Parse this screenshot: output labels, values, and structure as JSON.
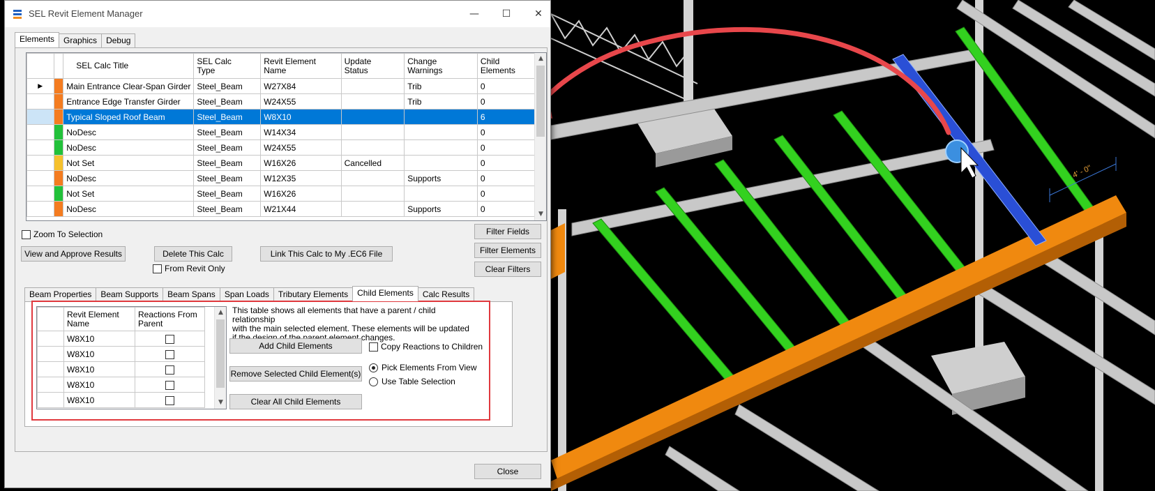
{
  "window": {
    "title": "SEL Revit Element Manager",
    "minimize_glyph": "—",
    "maximize_glyph": "☐",
    "close_glyph": "✕"
  },
  "top_tabs": [
    "Elements",
    "Graphics",
    "Debug"
  ],
  "grid": {
    "columns": [
      "SEL Calc Title",
      "SEL Calc\nType",
      "Revit Element\nName",
      "Update\nStatus",
      "Change\nWarnings",
      "Child\nElements"
    ],
    "rows": [
      {
        "marker": "▶",
        "color": "#f47c20",
        "title": "Main Entrance Clear-Span Girder",
        "type": "Steel_Beam",
        "name": "W27X84",
        "status": "",
        "warnings": "Trib",
        "child": "0"
      },
      {
        "marker": "",
        "color": "#f47c20",
        "title": "Entrance Edge Transfer Girder",
        "type": "Steel_Beam",
        "name": "W24X55",
        "status": "",
        "warnings": "Trib",
        "child": "0"
      },
      {
        "marker": "",
        "color": "#f47c20",
        "title": "Typical Sloped Roof Beam",
        "type": "Steel_Beam",
        "name": "W8X10",
        "status": "",
        "warnings": "",
        "child": "6"
      },
      {
        "marker": "",
        "color": "#22c13a",
        "title": "NoDesc",
        "type": "Steel_Beam",
        "name": "W14X34",
        "status": "",
        "warnings": "",
        "child": "0"
      },
      {
        "marker": "",
        "color": "#22c13a",
        "title": "NoDesc",
        "type": "Steel_Beam",
        "name": "W24X55",
        "status": "",
        "warnings": "",
        "child": "0"
      },
      {
        "marker": "",
        "color": "#f6c12d",
        "title": "Not Set",
        "type": "Steel_Beam",
        "name": "W16X26",
        "status": "Cancelled",
        "warnings": "",
        "child": "0"
      },
      {
        "marker": "",
        "color": "#f47c20",
        "title": "NoDesc",
        "type": "Steel_Beam",
        "name": "W12X35",
        "status": "",
        "warnings": "Supports",
        "child": "0"
      },
      {
        "marker": "",
        "color": "#22c13a",
        "title": "Not Set",
        "type": "Steel_Beam",
        "name": "W16X26",
        "status": "",
        "warnings": "",
        "child": "0"
      },
      {
        "marker": "",
        "color": "#f47c20",
        "title": "NoDesc",
        "type": "Steel_Beam",
        "name": "W21X44",
        "status": "",
        "warnings": "Supports",
        "child": "0"
      }
    ],
    "selected_index": 2
  },
  "controls": {
    "zoom_to_selection": "Zoom To Selection",
    "view_approve": "View and Approve Results",
    "delete_calc": "Delete This Calc",
    "from_revit_only": "From Revit Only",
    "link_calc": "Link This Calc to My .EC6 File",
    "filter_fields": "Filter Fields",
    "filter_elements": "Filter Elements",
    "clear_filters": "Clear Filters",
    "close": "Close"
  },
  "sub_tabs": [
    "Beam Properties",
    "Beam Supports",
    "Beam Spans",
    "Span Loads",
    "Tributary Elements",
    "Child Elements",
    "Calc Results"
  ],
  "child_panel": {
    "columns": [
      "Revit Element\nName",
      "Reactions From\nParent"
    ],
    "rows": [
      "W8X10",
      "W8X10",
      "W8X10",
      "W8X10",
      "W8X10"
    ],
    "description": [
      "This table shows all elements that have a parent / child relationship",
      "with the main selected element.  These elements will be updated",
      "if the design of the parent element changes."
    ],
    "add_child": "Add Child Elements",
    "remove_child": "Remove Selected Child Element(s)",
    "clear_child": "Clear All Child Elements",
    "copy_reactions": "Copy Reactions to Children",
    "pick_from_view": "Pick Elements From View",
    "use_table_selection": "Use Table Selection"
  },
  "scene": {
    "dimension_label": "4' - 0\"",
    "colors": {
      "steel": "#bdbdbd",
      "highlight_green": "#33d11f",
      "girder_orange": "#f0890f",
      "selected_blue": "#2a4fd6",
      "arrow_red": "#e8474b"
    }
  }
}
